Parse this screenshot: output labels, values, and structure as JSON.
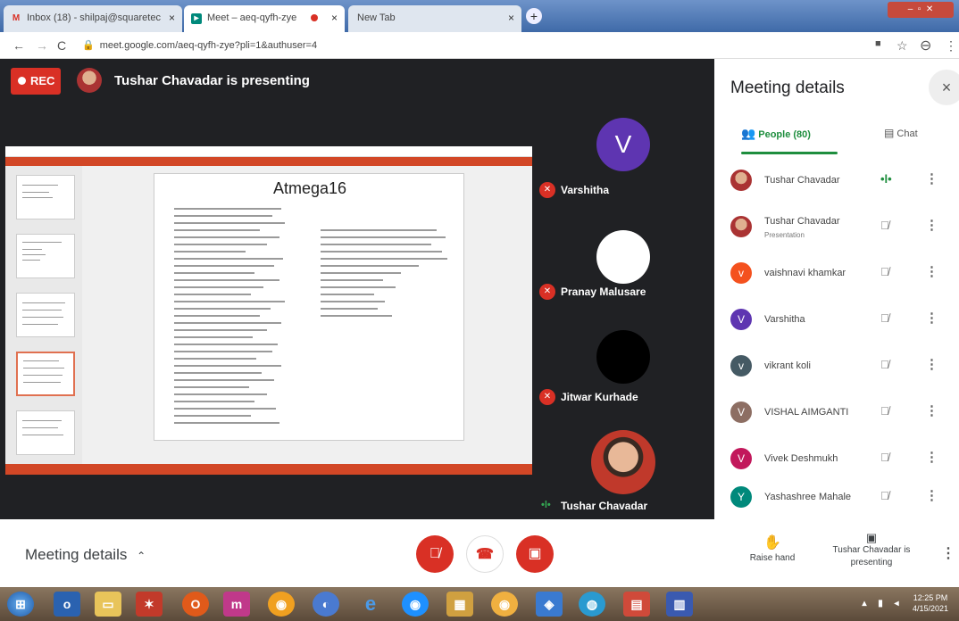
{
  "browser": {
    "tabs": [
      {
        "label": "Inbox (18) - shilpaj@squaretec",
        "favicon": "gmail-icon",
        "close": "×"
      },
      {
        "label": "Meet – aeq-qyfh-zye",
        "favicon": "meet-icon",
        "close": "×"
      },
      {
        "label": "New Tab",
        "favicon": "",
        "close": "×"
      }
    ],
    "new_tab": "+",
    "url": "meet.google.com/aeq-qyfh-zye?pli=1&authuser=4"
  },
  "stage": {
    "rec_label": "REC",
    "presenting_title": "Tushar Chavadar is presenting",
    "slide_title": "Atmega16"
  },
  "tiles": [
    {
      "name": "Varshitha",
      "initial": "V",
      "muted": true
    },
    {
      "name": "Pranay Malusare",
      "initial": "",
      "muted": true
    },
    {
      "name": "Jitwar Kurhade",
      "initial": "",
      "muted": true
    },
    {
      "name": "Tushar Chavadar",
      "initial": "",
      "muted": false
    }
  ],
  "panel": {
    "title": "Meeting details",
    "close": "×",
    "tab_people": "People (80)",
    "tab_chat": "Chat",
    "people": [
      {
        "name": "Tushar Chavadar",
        "sub": "",
        "initial": "",
        "color": "#b03a2e",
        "mic": "speaking"
      },
      {
        "name": "Tushar Chavadar",
        "sub": "Presentation",
        "initial": "",
        "color": "#b03a2e",
        "mic": "muted"
      },
      {
        "name": "vaishnavi khamkar",
        "sub": "",
        "initial": "v",
        "color": "#f4511e",
        "mic": "muted"
      },
      {
        "name": "Varshitha",
        "sub": "",
        "initial": "V",
        "color": "#5e35b1",
        "mic": "muted"
      },
      {
        "name": "vikrant koli",
        "sub": "",
        "initial": "v",
        "color": "#455a64",
        "mic": "muted"
      },
      {
        "name": "VISHAL AIMGANTI",
        "sub": "",
        "initial": "V",
        "color": "#8d6e63",
        "mic": "muted"
      },
      {
        "name": "Vivek Deshmukh",
        "sub": "",
        "initial": "V",
        "color": "#c2185b",
        "mic": "muted"
      },
      {
        "name": "Yashashree Mahale",
        "sub": "",
        "initial": "Y",
        "color": "#00897b",
        "mic": "muted"
      }
    ]
  },
  "bottom": {
    "meeting_details": "Meeting details",
    "raise_hand": "Raise hand",
    "presenting": "Tushar Chavadar is presenting"
  },
  "taskbar": {
    "time": "12:25 PM",
    "date": "4/15/2021"
  },
  "colors": {
    "accent_red": "#d93025",
    "meet_green": "#1e8e3e",
    "stage_bg": "#202124"
  }
}
